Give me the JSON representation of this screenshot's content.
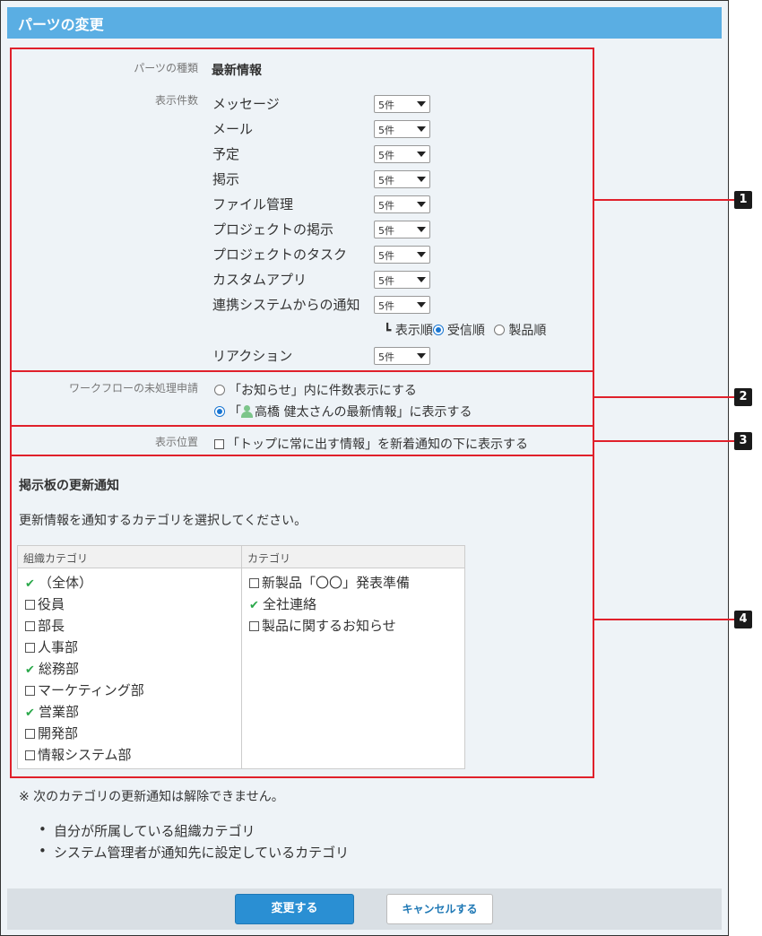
{
  "header": {
    "title": "パーツの変更"
  },
  "parts": {
    "type_label": "パーツの種類",
    "type_value": "最新情報",
    "count_label": "表示件数",
    "rows": [
      {
        "label": "メッセージ",
        "value": "5件"
      },
      {
        "label": "メール",
        "value": "5件"
      },
      {
        "label": "予定",
        "value": "5件"
      },
      {
        "label": "掲示",
        "value": "5件"
      },
      {
        "label": "ファイル管理",
        "value": "5件"
      },
      {
        "label": "プロジェクトの掲示",
        "value": "5件"
      },
      {
        "label": "プロジェクトのタスク",
        "value": "5件"
      },
      {
        "label": "カスタムアプリ",
        "value": "5件"
      },
      {
        "label": "連携システムからの通知",
        "value": "5件"
      },
      {
        "label": "リアクション",
        "value": "5件"
      }
    ],
    "order": {
      "prefix": "┗ 表示順",
      "received": "受信順",
      "product": "製品順",
      "selected": "received"
    }
  },
  "workflow": {
    "label": "ワークフローの未処理申請",
    "option1": "「お知らせ」内に件数表示にする",
    "option2_prefix": "「",
    "option2_name": "高橋 健太さんの最新情報",
    "option2_suffix": "」に表示する",
    "selected": 2
  },
  "position": {
    "label": "表示位置",
    "option": "「トップに常に出す情報」を新着通知の下に表示する"
  },
  "bulletin": {
    "title": "掲示板の更新通知",
    "instruction": "更新情報を通知するカテゴリを選択してください。",
    "org_header": "組織カテゴリ",
    "cat_header": "カテゴリ",
    "org_items": [
      {
        "label": "（全体）",
        "checked": true
      },
      {
        "label": "役員",
        "checked": false
      },
      {
        "label": "部長",
        "checked": false
      },
      {
        "label": "人事部",
        "checked": false
      },
      {
        "label": "総務部",
        "checked": true
      },
      {
        "label": "マーケティング部",
        "checked": false
      },
      {
        "label": "営業部",
        "checked": true
      },
      {
        "label": "開発部",
        "checked": false
      },
      {
        "label": "情報システム部",
        "checked": false
      }
    ],
    "cat_items": [
      {
        "label": "新製品「〇〇」発表準備",
        "checked": false
      },
      {
        "label": "全社連絡",
        "checked": true
      },
      {
        "label": "製品に関するお知らせ",
        "checked": false
      }
    ]
  },
  "note": {
    "text": "※ 次のカテゴリの更新通知は解除できません。",
    "bullets": [
      "自分が所属している組織カテゴリ",
      "システム管理者が通知先に設定しているカテゴリ"
    ]
  },
  "footer": {
    "submit": "変更する",
    "cancel": "キャンセルする"
  },
  "callouts": [
    "1",
    "2",
    "3",
    "4"
  ],
  "colors": {
    "accent": "#5aaee3",
    "callout": "#e0202b",
    "primary_button": "#2a8fd3"
  }
}
